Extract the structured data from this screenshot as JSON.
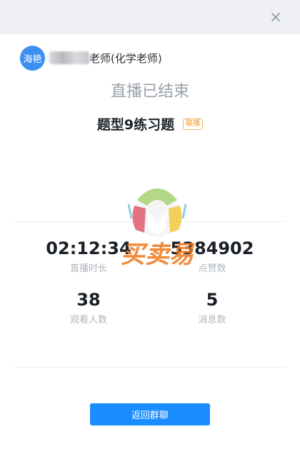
{
  "header": {
    "avatar_text": "海艳",
    "teacher_name": "老师(化学老师)"
  },
  "status_title": "直播已结束",
  "course": {
    "title": "题型9练习题",
    "tag": "联播"
  },
  "stats": [
    {
      "value": "02:12:34",
      "label": "直播时长"
    },
    {
      "value": "5384902",
      "label": "点赞数"
    },
    {
      "value": "38",
      "label": "观看人数"
    },
    {
      "value": "5",
      "label": "消息数"
    }
  ],
  "watermark_text": "买卖易",
  "back_button_label": "返回群聊",
  "colors": {
    "accent": "#1a8cff",
    "avatar": "#3d8ff2",
    "tag": "#e89a2b"
  }
}
